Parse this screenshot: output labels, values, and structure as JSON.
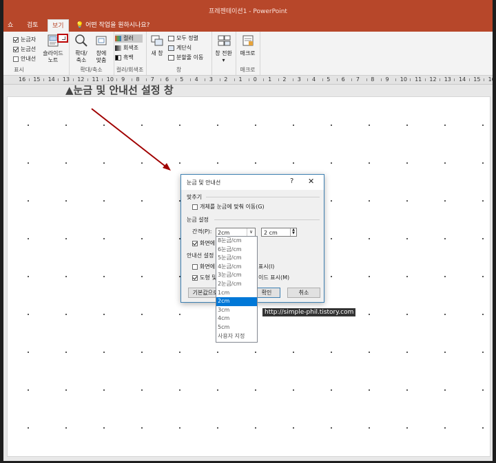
{
  "titlebar": {
    "title": "프레젠테이션1  -  PowerPoint",
    "bg": "#b7472a"
  },
  "tabs": {
    "show": "쇼",
    "review": "검토",
    "view": "보기",
    "tellme": "어떤 작업을 원하시나요?"
  },
  "ribbon": {
    "show": {
      "gridlines": "눈금자",
      "guides_row": "눈금선",
      "guides": "안내선",
      "notes": "슬라이드\n노트",
      "label": "표시"
    },
    "zoom": {
      "zoom": "확대/\n축소",
      "fit": "창에\n맞춤",
      "label": "확대/축소"
    },
    "color": {
      "color": "컬러",
      "grayscale": "회색조",
      "bw": "흑백",
      "label": "컬러/회색조"
    },
    "window": {
      "new": "새 창",
      "arrange": "모두 정렬",
      "cascade": "계단식",
      "split": "분할줄 이동",
      "label": "창"
    },
    "switch": {
      "switch": "창 전환"
    },
    "macro": {
      "macro": "매크로",
      "label": "매크로"
    }
  },
  "ruler": {
    "numbers": [
      "16",
      "15",
      "14",
      "13",
      "12",
      "11",
      "10",
      "9",
      "8",
      "7",
      "6",
      "5",
      "4",
      "3",
      "2",
      "1",
      "0",
      "1",
      "2",
      "3",
      "4",
      "5",
      "6",
      "7",
      "8",
      "9",
      "10",
      "11",
      "12",
      "13",
      "14",
      "15",
      "16"
    ]
  },
  "heading": "▲눈금 및 안내선 설정 창",
  "dialog": {
    "title": "눈금 및 안내선",
    "help": "?",
    "close": "✕",
    "snap_section": "맞추기",
    "snap_option": "개체를 눈금에 맞춰 이동(G)",
    "grid_section": "눈금 설정",
    "spacing_label": "간격(P):",
    "spacing_value": "2cm",
    "spacing_num": "2 cm",
    "show_grid": "화면에",
    "guides_section": "안내선 설정",
    "guide1": "화면에",
    "guide1_tail": "표시(I)",
    "guide2": "도형 및",
    "guide2_tail": "이드 표시(M)",
    "default_btn": "기본값으로",
    "ok_btn": "확인",
    "cancel_btn": "취소"
  },
  "dropdown": {
    "options": [
      "8눈금/cm",
      "6눈금/cm",
      "5눈금/cm",
      "4눈금/cm",
      "3눈금/cm",
      "2눈금/cm",
      "1cm",
      "2cm",
      "3cm",
      "4cm",
      "5cm",
      "사용자 지정"
    ],
    "selected": "2cm"
  },
  "watermark": "http://simple-phil.tistory.com",
  "accent_color": "#b00000"
}
